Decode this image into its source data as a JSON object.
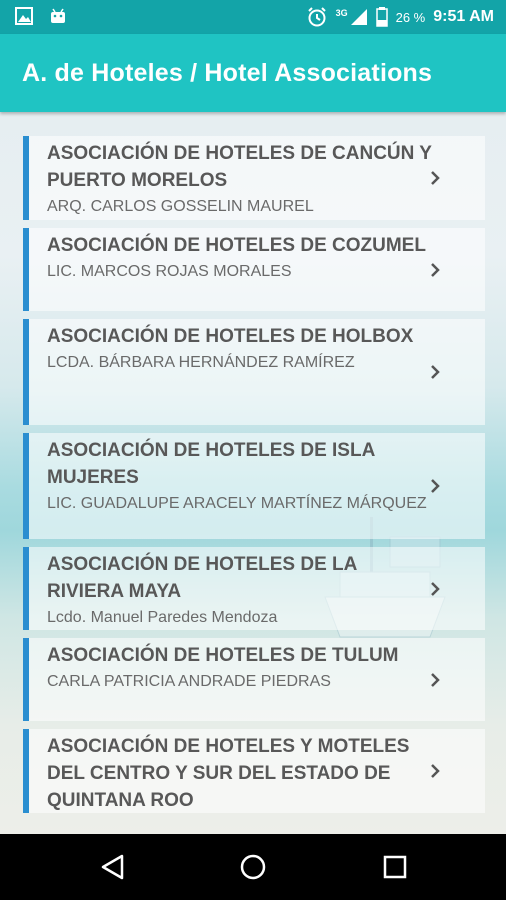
{
  "status_bar": {
    "signal_label": "3G",
    "battery": "26 %",
    "time": "9:51 AM"
  },
  "app_bar": {
    "title": "A. de Hoteles / Hotel Associations"
  },
  "associations": [
    {
      "name": "ASOCIACIÓN DE HOTELES DE CANCÚN Y PUERTO MORELOS",
      "person": "ARQ. CARLOS GOSSELIN MAUREL"
    },
    {
      "name": "ASOCIACIÓN DE HOTELES DE COZUMEL",
      "person": "LIC. MARCOS ROJAS MORALES"
    },
    {
      "name": "ASOCIACIÓN DE HOTELES DE HOLBOX",
      "person": "LCDA. BÁRBARA HERNÁNDEZ RAMÍREZ"
    },
    {
      "name": "ASOCIACIÓN DE HOTELES DE ISLA MUJERES",
      "person": "LIC. GUADALUPE ARACELY MARTÍNEZ MÁRQUEZ"
    },
    {
      "name": "ASOCIACIÓN DE HOTELES DE LA RIVIERA MAYA",
      "person": "Lcdo. Manuel Paredes Mendoza"
    },
    {
      "name": "ASOCIACIÓN DE HOTELES DE TULUM",
      "person": "CARLA PATRICIA ANDRADE PIEDRAS"
    },
    {
      "name": "ASOCIACIÓN DE HOTELES Y MOTELES DEL CENTRO Y SUR DEL ESTADO DE QUINTANA ROO",
      "person": ""
    }
  ],
  "colors": {
    "status_bar": "#13a4a8",
    "app_bar": "#1fc4c3",
    "row_accent": "#2a8ed0",
    "text": "#585858"
  },
  "icons": {
    "row_arrow": "chevron-right-icon",
    "nav": [
      "back-icon",
      "home-icon",
      "recents-icon"
    ]
  }
}
